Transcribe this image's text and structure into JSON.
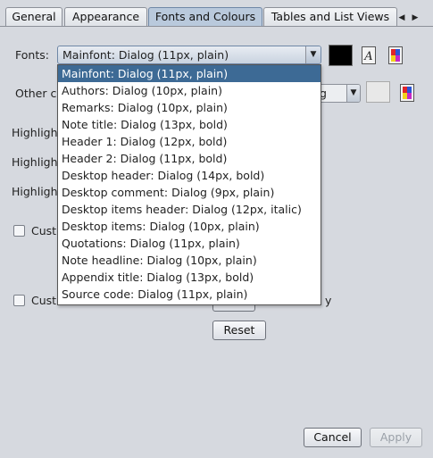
{
  "tabs": [
    "General",
    "Appearance",
    "Fonts and Colours",
    "Tables and List Views"
  ],
  "labels": {
    "fonts": "Fonts:",
    "other": "Other c",
    "highlight": "Highlight",
    "custom": "Cust",
    "custom2_tail": "y"
  },
  "font_combo": {
    "value": "Mainfont: Dialog (11px, plain)"
  },
  "other_combo": {
    "value": "g"
  },
  "font_options": [
    "Mainfont: Dialog (11px, plain)",
    "Authors: Dialog (10px, plain)",
    "Remarks: Dialog (10px, plain)",
    "Note title: Dialog (13px, bold)",
    "Header 1: Dialog (12px, bold)",
    "Header 2: Dialog (11px, bold)",
    "Desktop header: Dialog (14px, bold)",
    "Desktop comment: Dialog (9px, plain)",
    "Desktop items header: Dialog (12px, italic)",
    "Desktop items: Dialog (10px, plain)",
    "Quotations: Dialog (11px, plain)",
    "Note headline: Dialog (10px, plain)",
    "Appendix title: Dialog (13px, bold)",
    "Source code: Dialog (11px, plain)"
  ],
  "buttons": {
    "reset": "Reset",
    "cancel": "Cancel",
    "apply": "Apply"
  },
  "colors": {
    "font_color": "#000000",
    "other_color": "#e8e8e8",
    "selected": "#3d6a95"
  },
  "icons": {
    "font_style": "font-style-icon",
    "palette": "color-palette-icon",
    "tab_left": "chevron-left-icon",
    "tab_right": "chevron-right-icon",
    "dropdown": "chevron-down-icon"
  }
}
